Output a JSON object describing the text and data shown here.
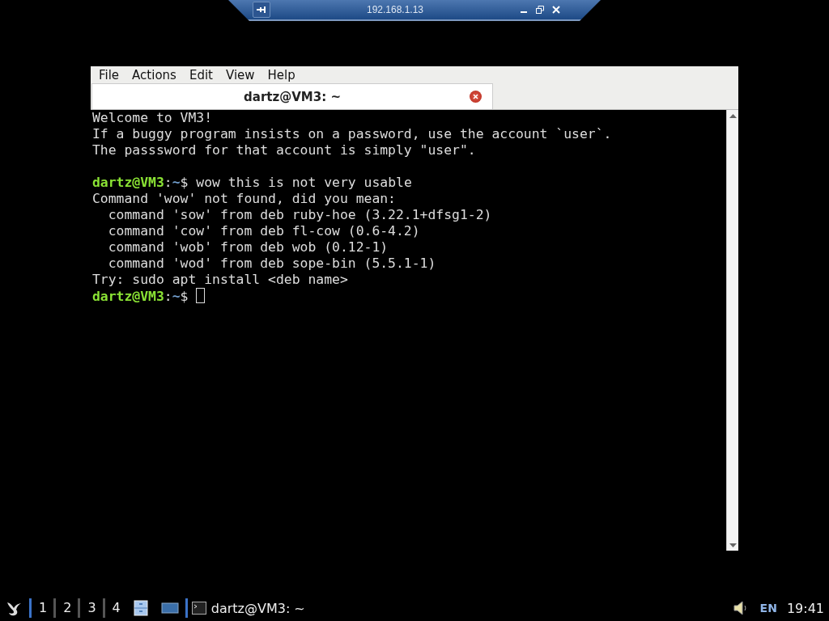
{
  "remote_bar": {
    "title": "192.168.1.13"
  },
  "window": {
    "menu": [
      "File",
      "Actions",
      "Edit",
      "View",
      "Help"
    ],
    "tabs": [
      {
        "label": "dartz@VM3: ~",
        "selected": true
      }
    ],
    "terminal": [
      {
        "kind": "output",
        "text": "Welcome to VM3!"
      },
      {
        "kind": "output",
        "text": "If a buggy program insists on a password, use the account `user`."
      },
      {
        "kind": "output",
        "text": "The passsword for that account is simply \"user\"."
      },
      {
        "kind": "blank"
      },
      {
        "kind": "prompt",
        "user": "dartz@VM3",
        "sep": ":",
        "path": "~",
        "symbol": "$",
        "command": "wow this is not very usable"
      },
      {
        "kind": "output",
        "text": "Command 'wow' not found, did you mean:"
      },
      {
        "kind": "output",
        "text": "  command 'sow' from deb ruby-hoe (3.22.1+dfsg1-2)"
      },
      {
        "kind": "output",
        "text": "  command 'cow' from deb fl-cow (0.6-4.2)"
      },
      {
        "kind": "output",
        "text": "  command 'wob' from deb wob (0.12-1)"
      },
      {
        "kind": "output",
        "text": "  command 'wod' from deb sope-bin (5.5.1-1)"
      },
      {
        "kind": "output",
        "text": "Try: sudo apt install <deb name>"
      },
      {
        "kind": "prompt",
        "user": "dartz@VM3",
        "sep": ":",
        "path": "~",
        "symbol": "$",
        "cursor": true
      }
    ]
  },
  "taskbar": {
    "workspaces": [
      {
        "label": "1",
        "selected": true
      },
      {
        "label": "2",
        "selected": false
      },
      {
        "label": "3",
        "selected": false
      },
      {
        "label": "4",
        "selected": false
      }
    ],
    "tasks": [
      {
        "label": "dartz@VM3: ~",
        "selected": true
      }
    ],
    "language": "EN",
    "clock": "19:41"
  }
}
